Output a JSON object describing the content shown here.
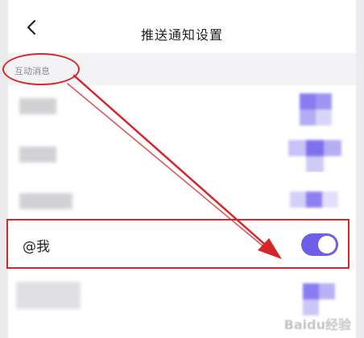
{
  "header": {
    "back_icon": "chevron-left-icon",
    "title": "推送通知设置"
  },
  "section": {
    "label": "互动消息"
  },
  "rows": [
    {
      "label": "",
      "toggle": "on",
      "blurred": true
    },
    {
      "label": "",
      "toggle": "on",
      "blurred": true
    },
    {
      "label": "",
      "toggle": "on",
      "blurred": true
    },
    {
      "label": "@我",
      "toggle": "on",
      "blurred": false
    },
    {
      "label": "",
      "toggle": "on",
      "blurred": true
    }
  ],
  "colors": {
    "toggle_on": "#6f5fe6",
    "annotation": "#d6262b"
  },
  "watermark": "Baidu经验"
}
